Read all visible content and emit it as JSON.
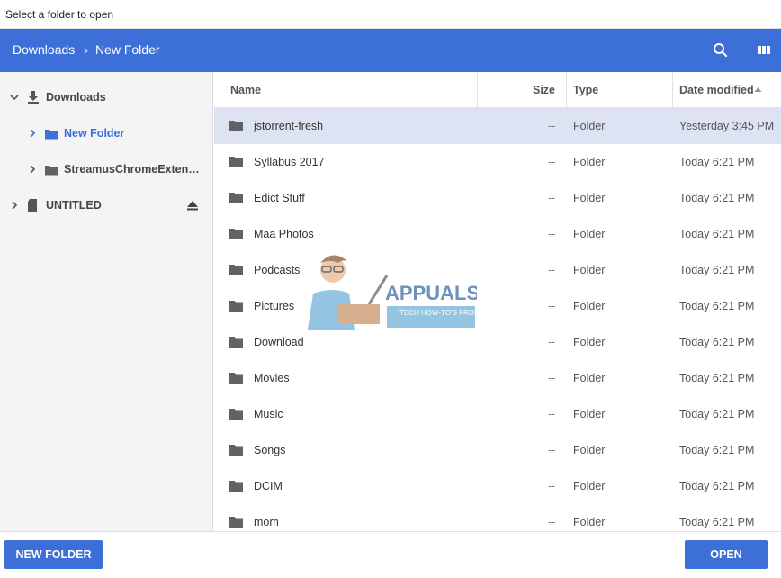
{
  "window": {
    "title": "Select a folder to open"
  },
  "header": {
    "breadcrumbs": [
      "Downloads",
      "New Folder"
    ],
    "separator": "›",
    "icons": [
      "search-icon",
      "grid-view-icon"
    ],
    "accent_color": "#3d6fd8"
  },
  "sidebar": {
    "items": [
      {
        "label": "Downloads",
        "icon": "download-icon",
        "expanded": true
      },
      {
        "label": "New Folder",
        "icon": "folder-icon",
        "active": true
      },
      {
        "label": "StreamusChromeExtensi…",
        "icon": "folder-icon"
      },
      {
        "label": "UNTITLED",
        "icon": "sd-card-icon",
        "eject_icon": "eject-icon"
      }
    ]
  },
  "file_list": {
    "columns": {
      "name": "Name",
      "size": "Size",
      "type": "Type",
      "date": "Date modified"
    },
    "sort": {
      "column": "Date modified",
      "direction": "ascending"
    },
    "rows": [
      {
        "name": "jstorrent-fresh",
        "size": "--",
        "type": "Folder",
        "date": "Yesterday 3:45 PM",
        "selected": true
      },
      {
        "name": "Syllabus 2017",
        "size": "--",
        "type": "Folder",
        "date": "Today 6:21 PM"
      },
      {
        "name": "Edict Stuff",
        "size": "--",
        "type": "Folder",
        "date": "Today 6:21 PM"
      },
      {
        "name": "Maa Photos",
        "size": "--",
        "type": "Folder",
        "date": "Today 6:21 PM"
      },
      {
        "name": "Podcasts",
        "size": "--",
        "type": "Folder",
        "date": "Today 6:21 PM"
      },
      {
        "name": "Pictures",
        "size": "--",
        "type": "Folder",
        "date": "Today 6:21 PM"
      },
      {
        "name": "Download",
        "size": "--",
        "type": "Folder",
        "date": "Today 6:21 PM"
      },
      {
        "name": "Movies",
        "size": "--",
        "type": "Folder",
        "date": "Today 6:21 PM"
      },
      {
        "name": "Music",
        "size": "--",
        "type": "Folder",
        "date": "Today 6:21 PM"
      },
      {
        "name": "Songs",
        "size": "--",
        "type": "Folder",
        "date": "Today 6:21 PM"
      },
      {
        "name": "DCIM",
        "size": "--",
        "type": "Folder",
        "date": "Today 6:21 PM"
      },
      {
        "name": "mom",
        "size": "--",
        "type": "Folder",
        "date": "Today 6:21 PM"
      }
    ]
  },
  "watermark": {
    "brand": "APPUALS",
    "tagline": "TECH HOW-TO'S FROM THE EXPERTS!"
  },
  "footer": {
    "new_folder_label": "NEW FOLDER",
    "open_label": "OPEN"
  }
}
